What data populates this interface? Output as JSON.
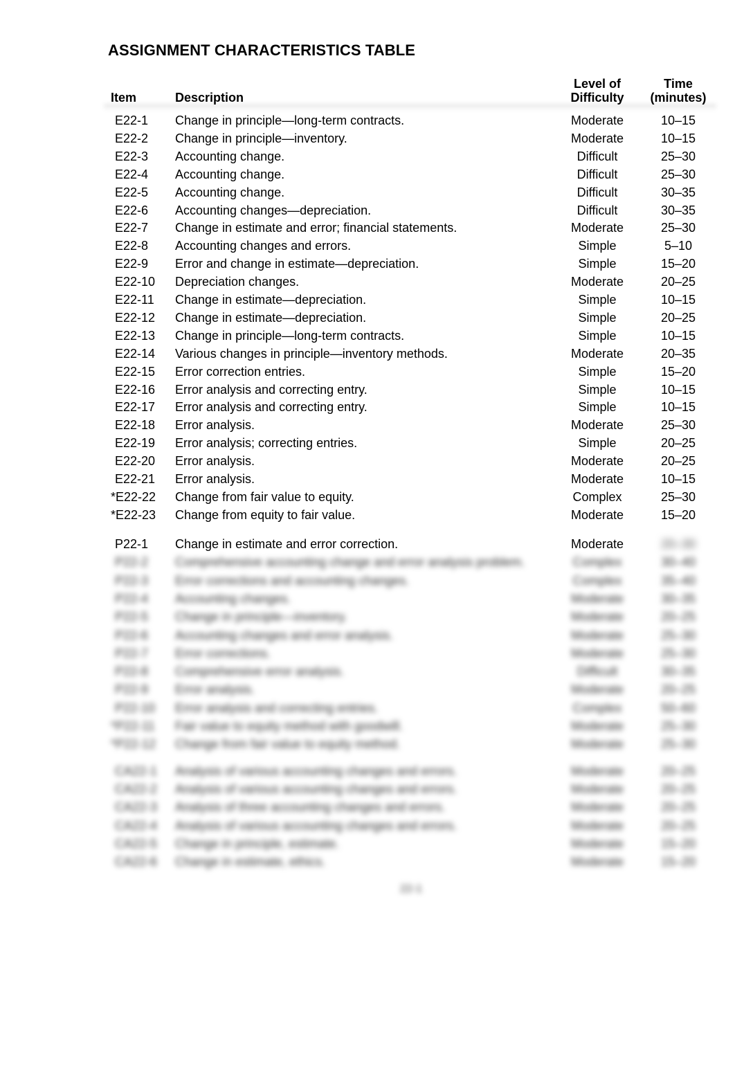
{
  "title": "ASSIGNMENT CHARACTERISTICS TABLE",
  "headers": {
    "item": "Item",
    "description": "Description",
    "difficulty_line1": "Level of",
    "difficulty_line2": "Difficulty",
    "time_line1": "Time",
    "time_line2": "(minutes)"
  },
  "exercises": [
    {
      "item": "E22-1",
      "description": "Change in principle—long-term contracts.",
      "difficulty": "Moderate",
      "time": "10–15"
    },
    {
      "item": "E22-2",
      "description": "Change in principle—inventory.",
      "difficulty": "Moderate",
      "time": "10–15"
    },
    {
      "item": "E22-3",
      "description": "Accounting change.",
      "difficulty": "Difficult",
      "time": "25–30"
    },
    {
      "item": "E22-4",
      "description": "Accounting change.",
      "difficulty": "Difficult",
      "time": "25–30"
    },
    {
      "item": "E22-5",
      "description": "Accounting change.",
      "difficulty": "Difficult",
      "time": "30–35"
    },
    {
      "item": "E22-6",
      "description": "Accounting changes—depreciation.",
      "difficulty": "Difficult",
      "time": "30–35"
    },
    {
      "item": "E22-7",
      "description": "Change in estimate and error; financial statements.",
      "difficulty": "Moderate",
      "time": "25–30"
    },
    {
      "item": "E22-8",
      "description": "Accounting changes and errors.",
      "difficulty": "Simple",
      "time": "5–10"
    },
    {
      "item": "E22-9",
      "description": "Error and change in estimate—depreciation.",
      "difficulty": "Simple",
      "time": "15–20"
    },
    {
      "item": "E22-10",
      "description": "Depreciation changes.",
      "difficulty": "Moderate",
      "time": "20–25"
    },
    {
      "item": "E22-11",
      "description": "Change in estimate—depreciation.",
      "difficulty": "Simple",
      "time": "10–15"
    },
    {
      "item": "E22-12",
      "description": "Change in estimate—depreciation.",
      "difficulty": "Simple",
      "time": "20–25"
    },
    {
      "item": "E22-13",
      "description": "Change in principle—long-term contracts.",
      "difficulty": "Simple",
      "time": "10–15"
    },
    {
      "item": "E22-14",
      "description": "Various changes in principle—inventory methods.",
      "difficulty": "Moderate",
      "time": "20–35"
    },
    {
      "item": "E22-15",
      "description": "Error correction entries.",
      "difficulty": "Simple",
      "time": "15–20"
    },
    {
      "item": "E22-16",
      "description": "Error analysis and correcting entry.",
      "difficulty": "Simple",
      "time": "10–15"
    },
    {
      "item": "E22-17",
      "description": "Error analysis and correcting entry.",
      "difficulty": "Simple",
      "time": "10–15"
    },
    {
      "item": "E22-18",
      "description": "Error analysis.",
      "difficulty": "Moderate",
      "time": "25–30"
    },
    {
      "item": "E22-19",
      "description": "Error analysis; correcting entries.",
      "difficulty": "Simple",
      "time": "20–25"
    },
    {
      "item": "E22-20",
      "description": "Error analysis.",
      "difficulty": "Moderate",
      "time": "20–25"
    },
    {
      "item": "E22-21",
      "description": "Error analysis.",
      "difficulty": "Moderate",
      "time": "10–15"
    },
    {
      "item": "*E22-22",
      "description": "Change from fair value to equity.",
      "difficulty": "Complex",
      "time": "25–30"
    },
    {
      "item": "*E22-23",
      "description": "Change from equity to fair value.",
      "difficulty": "Moderate",
      "time": "15–20"
    }
  ],
  "problems": [
    {
      "item": "P22-1",
      "description": "Change in estimate and error correction.",
      "difficulty": "Moderate",
      "time": "20–30"
    },
    {
      "item": "P22-2",
      "description": "Comprehensive accounting change and error analysis problem.",
      "difficulty": "Complex",
      "time": "30–40"
    },
    {
      "item": "P22-3",
      "description": "Error corrections and accounting changes.",
      "difficulty": "Complex",
      "time": "35–40"
    },
    {
      "item": "P22-4",
      "description": "Accounting changes.",
      "difficulty": "Moderate",
      "time": "30–35"
    },
    {
      "item": "P22-5",
      "description": "Change in principle—inventory.",
      "difficulty": "Moderate",
      "time": "20–25"
    },
    {
      "item": "P22-6",
      "description": "Accounting changes and error analysis.",
      "difficulty": "Moderate",
      "time": "25–30"
    },
    {
      "item": "P22-7",
      "description": "Error corrections.",
      "difficulty": "Moderate",
      "time": "25–30"
    },
    {
      "item": "P22-8",
      "description": "Comprehensive error analysis.",
      "difficulty": "Difficult",
      "time": "30–35"
    },
    {
      "item": "P22-9",
      "description": "Error analysis.",
      "difficulty": "Moderate",
      "time": "20–25"
    },
    {
      "item": "P22-10",
      "description": "Error analysis and correcting entries.",
      "difficulty": "Complex",
      "time": "50–60"
    },
    {
      "item": "*P22-11",
      "description": "Fair value to equity method with goodwill.",
      "difficulty": "Moderate",
      "time": "25–30"
    },
    {
      "item": "*P22-12",
      "description": "Change from fair value to equity method.",
      "difficulty": "Moderate",
      "time": "25–30"
    }
  ],
  "concepts": [
    {
      "item": "CA22-1",
      "description": "Analysis of various accounting changes and errors.",
      "difficulty": "Moderate",
      "time": "20–25"
    },
    {
      "item": "CA22-2",
      "description": "Analysis of various accounting changes and errors.",
      "difficulty": "Moderate",
      "time": "20–25"
    },
    {
      "item": "CA22-3",
      "description": "Analysis of three accounting changes and errors.",
      "difficulty": "Moderate",
      "time": "20–25"
    },
    {
      "item": "CA22-4",
      "description": "Analysis of various accounting changes and errors.",
      "difficulty": "Moderate",
      "time": "20–25"
    },
    {
      "item": "CA22-5",
      "description": "Change in principle, estimate.",
      "difficulty": "Moderate",
      "time": "15–20"
    },
    {
      "item": "CA22-6",
      "description": "Change in estimate, ethics.",
      "difficulty": "Moderate",
      "time": "15–20"
    }
  ],
  "page_number": "22-1"
}
